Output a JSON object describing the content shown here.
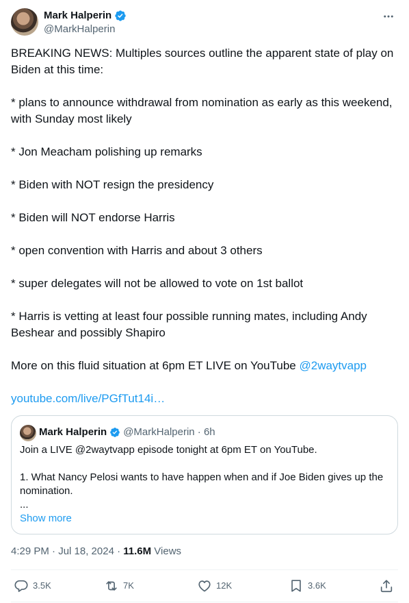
{
  "author": {
    "name": "Mark Halperin",
    "handle": "@MarkHalperin"
  },
  "tweet": {
    "lines": [
      "BREAKING NEWS: Multiples sources outline the apparent state of play on Biden at this time:",
      "* plans to announce withdrawal from nomination as early as this weekend, with Sunday most likely",
      "* Jon Meacham polishing up remarks",
      "* Biden with NOT resign the presidency",
      "* Biden will NOT endorse Harris",
      "* open convention with Harris and about 3 others",
      "* super delegates will not be allowed to vote on 1st ballot",
      "* Harris is vetting at least four possible running mates, including Andy Beshear and possibly Shapiro"
    ],
    "more_prefix": "More on this fluid situation at 6pm ET LIVE on YouTube ",
    "mention": "@2waytvapp",
    "link": "youtube.com/live/PGfTut14i…"
  },
  "quote": {
    "name": "Mark Halperin",
    "handle_time": "@MarkHalperin · 6h",
    "line1": "Join a LIVE @2waytvapp episode tonight at 6pm ET on YouTube.",
    "line2": "1. What Nancy Pelosi wants to have happen when and if Joe Biden gives up the nomination.",
    "line3": "...",
    "show_more": "Show more"
  },
  "meta": {
    "time": "4:29 PM · Jul 18, 2024 · ",
    "views_count": "11.6M",
    "views_label": " Views"
  },
  "actions": {
    "replies": "3.5K",
    "reposts": "7K",
    "likes": "12K",
    "bookmarks": "3.6K"
  },
  "colors": {
    "accent": "#1d9bf0",
    "text": "#0f1419",
    "secondary": "#536471",
    "border": "#cfd9de"
  }
}
